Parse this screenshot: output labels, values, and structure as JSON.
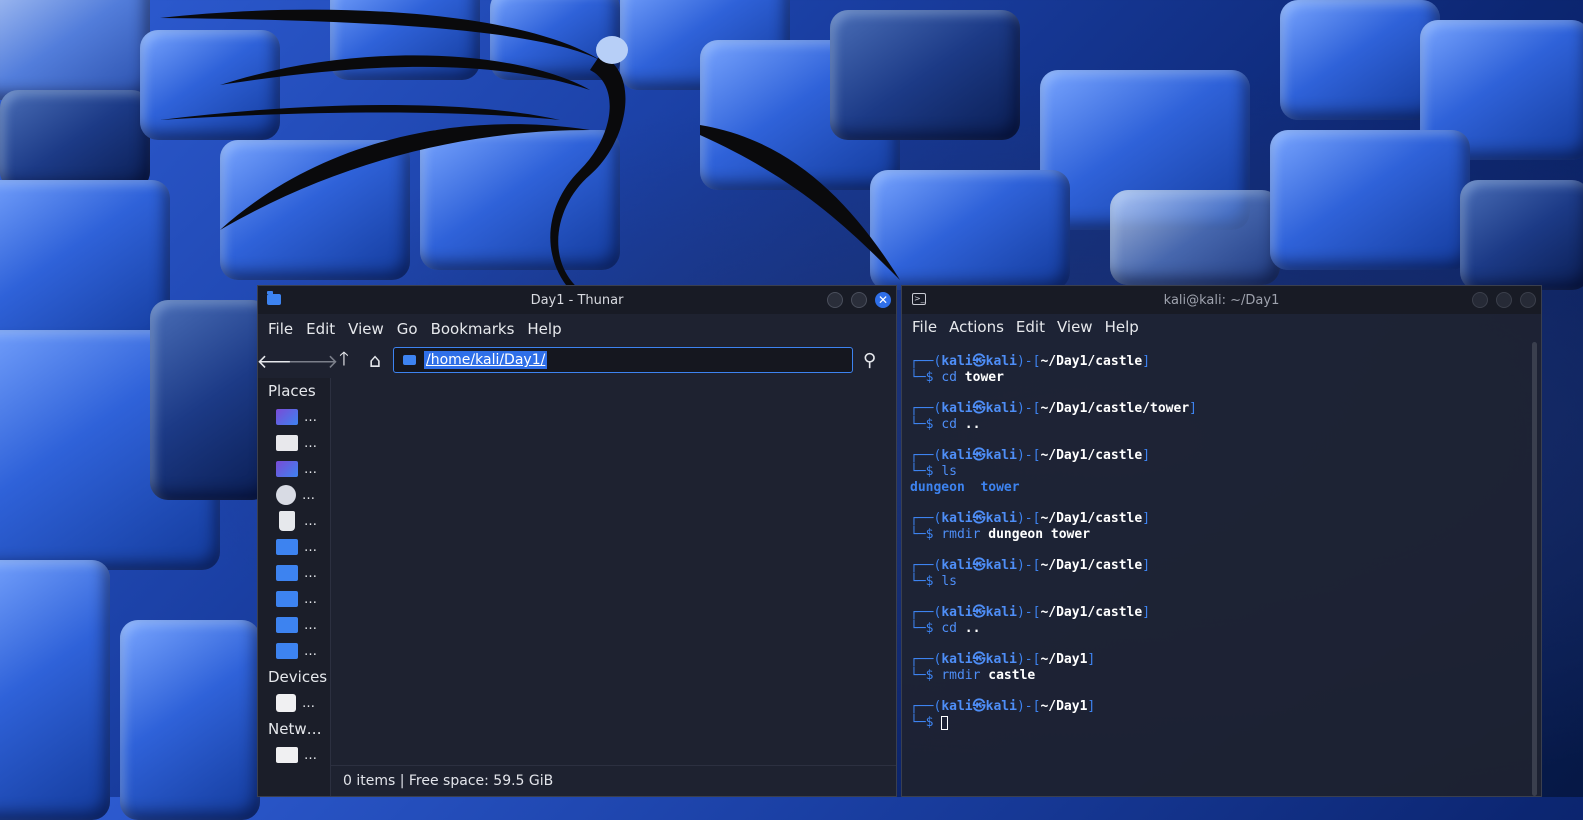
{
  "thunar": {
    "title": "Day1 - Thunar",
    "close_glyph": "✕",
    "menu": [
      "File",
      "Edit",
      "View",
      "Go",
      "Bookmarks",
      "Help"
    ],
    "toolbar": {
      "back_glyph": "🡐",
      "forward_glyph": "🡒",
      "up_glyph": "🡑",
      "home_glyph": "⌂",
      "search_glyph": "⚲"
    },
    "path": "/home/kali/Day1/",
    "sidebar": {
      "places_label": "Places",
      "place_items": [
        "…",
        "…",
        "…",
        "…",
        "…",
        "…",
        "…",
        "…",
        "…",
        "…"
      ],
      "devices_label": "Devices",
      "device_items": [
        "…"
      ],
      "network_label": "Netw…",
      "network_items": [
        "…"
      ]
    },
    "status": "0 items  |  Free space: 59.5 GiB"
  },
  "terminal": {
    "title": "kali@kali: ~/Day1",
    "menu": [
      "File",
      "Actions",
      "Edit",
      "View",
      "Help"
    ],
    "prompt_user": "kali",
    "prompt_at": "㉿",
    "prompt_host": "kali",
    "blocks": [
      {
        "path": "~/Day1/castle",
        "cmd": "cd",
        "args": "tower",
        "output": ""
      },
      {
        "path": "~/Day1/castle/tower",
        "cmd": "cd",
        "args": "..",
        "output": ""
      },
      {
        "path": "~/Day1/castle",
        "cmd": "ls",
        "args": "",
        "output": "dungeon  tower"
      },
      {
        "path": "~/Day1/castle",
        "cmd": "rmdir",
        "args": "dungeon tower",
        "output": ""
      },
      {
        "path": "~/Day1/castle",
        "cmd": "ls",
        "args": "",
        "output": ""
      },
      {
        "path": "~/Day1/castle",
        "cmd": "cd",
        "args": "..",
        "output": ""
      },
      {
        "path": "~/Day1",
        "cmd": "rmdir",
        "args": "castle",
        "output": ""
      },
      {
        "path": "~/Day1",
        "cmd": "",
        "args": "",
        "output": ""
      }
    ]
  }
}
